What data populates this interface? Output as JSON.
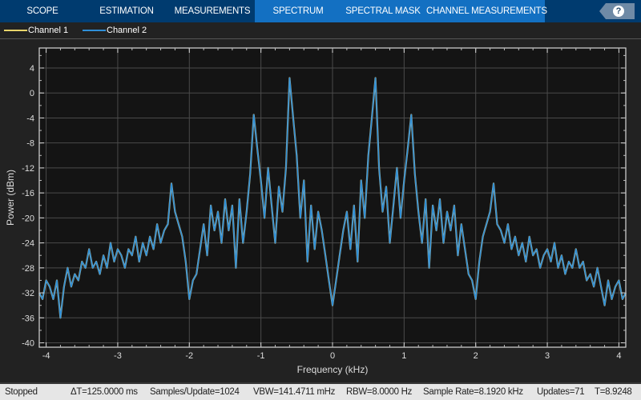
{
  "toolbar": {
    "tabs": [
      "SCOPE",
      "ESTIMATION",
      "MEASUREMENTS",
      "SPECTRUM",
      "SPECTRAL MASK",
      "CHANNEL MEASUREMENTS"
    ],
    "help_label": "?",
    "colors": {
      "bar": "#003b6f",
      "active_group": "#1370c2"
    }
  },
  "legend": [
    {
      "label": "Channel 1",
      "color": "#e8d46a"
    },
    {
      "label": "Channel 2",
      "color": "#2f8fd8"
    }
  ],
  "chart_data": {
    "type": "line",
    "title": "",
    "xlabel": "Frequency (kHz)",
    "ylabel": "Power (dBm)",
    "xlim": [
      -4.096,
      4.096
    ],
    "ylim": [
      -40.7,
      7.2
    ],
    "xticks": [
      -4,
      -3,
      -2,
      -1,
      0,
      1,
      2,
      3,
      4
    ],
    "yticks": [
      4,
      0,
      -4,
      -8,
      -12,
      -16,
      -20,
      -24,
      -28,
      -32,
      -36,
      -40
    ],
    "grid": true,
    "x_start": -4.1,
    "x_step": 0.05,
    "series": [
      {
        "name": "Channel 1",
        "color": "#c8c08a"
      },
      {
        "name": "Channel 2",
        "color": "#2f8fd8"
      }
    ],
    "values": [
      -32,
      -33,
      -30,
      -31,
      -33,
      -30,
      -36,
      -31,
      -28,
      -31,
      -29,
      -30,
      -27,
      -28,
      -25,
      -28,
      -27,
      -29,
      -26,
      -28,
      -24,
      -27,
      -25,
      -26,
      -28,
      -25,
      -26,
      -23,
      -27,
      -24,
      -26,
      -23,
      -25,
      -21,
      -24,
      -22,
      -21,
      -14.5,
      -19,
      -21,
      -23,
      -27,
      -33,
      -30,
      -29,
      -25,
      -21,
      -26,
      -18,
      -22,
      -19,
      -24,
      -17,
      -22,
      -18,
      -28,
      -17,
      -24,
      -19,
      -13,
      -3.5,
      -9,
      -14,
      -20,
      -12,
      -18,
      -24,
      -15,
      -19,
      -12,
      2.4,
      -4,
      -10,
      -20,
      -14,
      -27,
      -18,
      -25,
      -19,
      -22,
      -26,
      -30,
      -34,
      -30,
      -26,
      -22,
      -19,
      -25,
      -18,
      -27,
      -14,
      -20,
      -10,
      -4,
      2.4,
      -12,
      -19,
      -15,
      -24,
      -18,
      -12,
      -20,
      -14,
      -9,
      -3.5,
      -13,
      -19,
      -24,
      -17,
      -28,
      -18,
      -22,
      -17,
      -24,
      -19,
      -22,
      -18,
      -26,
      -21,
      -25,
      -29,
      -30,
      -33,
      -27,
      -23,
      -21,
      -19,
      -14.5,
      -21,
      -22,
      -24,
      -21,
      -25,
      -23,
      -26,
      -24,
      -27,
      -23,
      -26,
      -25,
      -28,
      -26,
      -25,
      -27,
      -24,
      -28,
      -26,
      -29,
      -27,
      -28,
      -25,
      -28,
      -27,
      -30,
      -29,
      -31,
      -28,
      -31,
      -34,
      -30,
      -33,
      -31,
      -30,
      -33,
      -32
    ]
  },
  "status": {
    "state": "Stopped",
    "delta_t": "ΔT=125.0000 ms",
    "samples_per_update": "Samples/Update=1024",
    "vbw": "VBW=141.4711 mHz",
    "rbw": "RBW=8.0000 Hz",
    "sample_rate": "Sample Rate=8.1920 kHz",
    "updates": "Updates=71",
    "time": "T=8.9248"
  }
}
